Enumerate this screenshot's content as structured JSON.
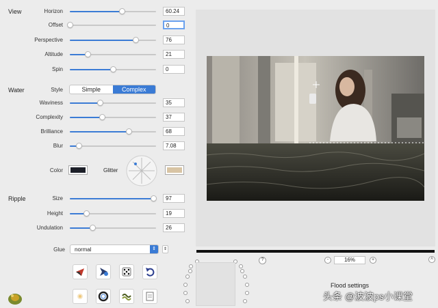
{
  "sections": {
    "view": "View",
    "water": "Water",
    "ripple": "Ripple"
  },
  "view": {
    "horizon": {
      "label": "Horizon",
      "value": "60.24",
      "level": 0.6
    },
    "offset": {
      "label": "Offset",
      "value": "0",
      "level": 0.0
    },
    "perspective": {
      "label": "Perspective",
      "value": "76",
      "level": 0.76
    },
    "altitude": {
      "label": "Altitude",
      "value": "21",
      "level": 0.21
    },
    "spin": {
      "label": "Spin",
      "value": "0",
      "level": 0.5
    }
  },
  "water": {
    "style_label": "Style",
    "style_options": [
      "Simple",
      "Complex"
    ],
    "style_selected": "Complex",
    "waviness": {
      "label": "Waviness",
      "value": "35",
      "level": 0.35
    },
    "complexity": {
      "label": "Complexity",
      "value": "37",
      "level": 0.37
    },
    "brilliance": {
      "label": "Brilliance",
      "value": "68",
      "level": 0.68
    },
    "blur": {
      "label": "Blur",
      "value": "7.08",
      "level": 0.1
    },
    "color_label": "Color",
    "color_value": "#1c1f28",
    "glitter_label": "Glitter",
    "glitter_color": "#d8c4a4"
  },
  "ripple": {
    "size": {
      "label": "Size",
      "value": "97",
      "level": 0.97
    },
    "height": {
      "label": "Height",
      "value": "19",
      "level": 0.19
    },
    "undulation": {
      "label": "Undulation",
      "value": "26",
      "level": 0.26
    }
  },
  "glue": {
    "label": "Glue",
    "value": "normal"
  },
  "tools_row1": [
    "shape-tool-icon",
    "arrow-tool-icon",
    "dice-icon",
    "undo-icon"
  ],
  "tools_row2": [
    "sparkle-icon",
    "ring-icon",
    "wave-icon",
    "document-icon"
  ],
  "help": "?",
  "zoom": {
    "minus": "-",
    "value": "16%",
    "plus": "+"
  },
  "preset_title": "Flood settings",
  "watermark": "头条 @波波ps小课堂"
}
